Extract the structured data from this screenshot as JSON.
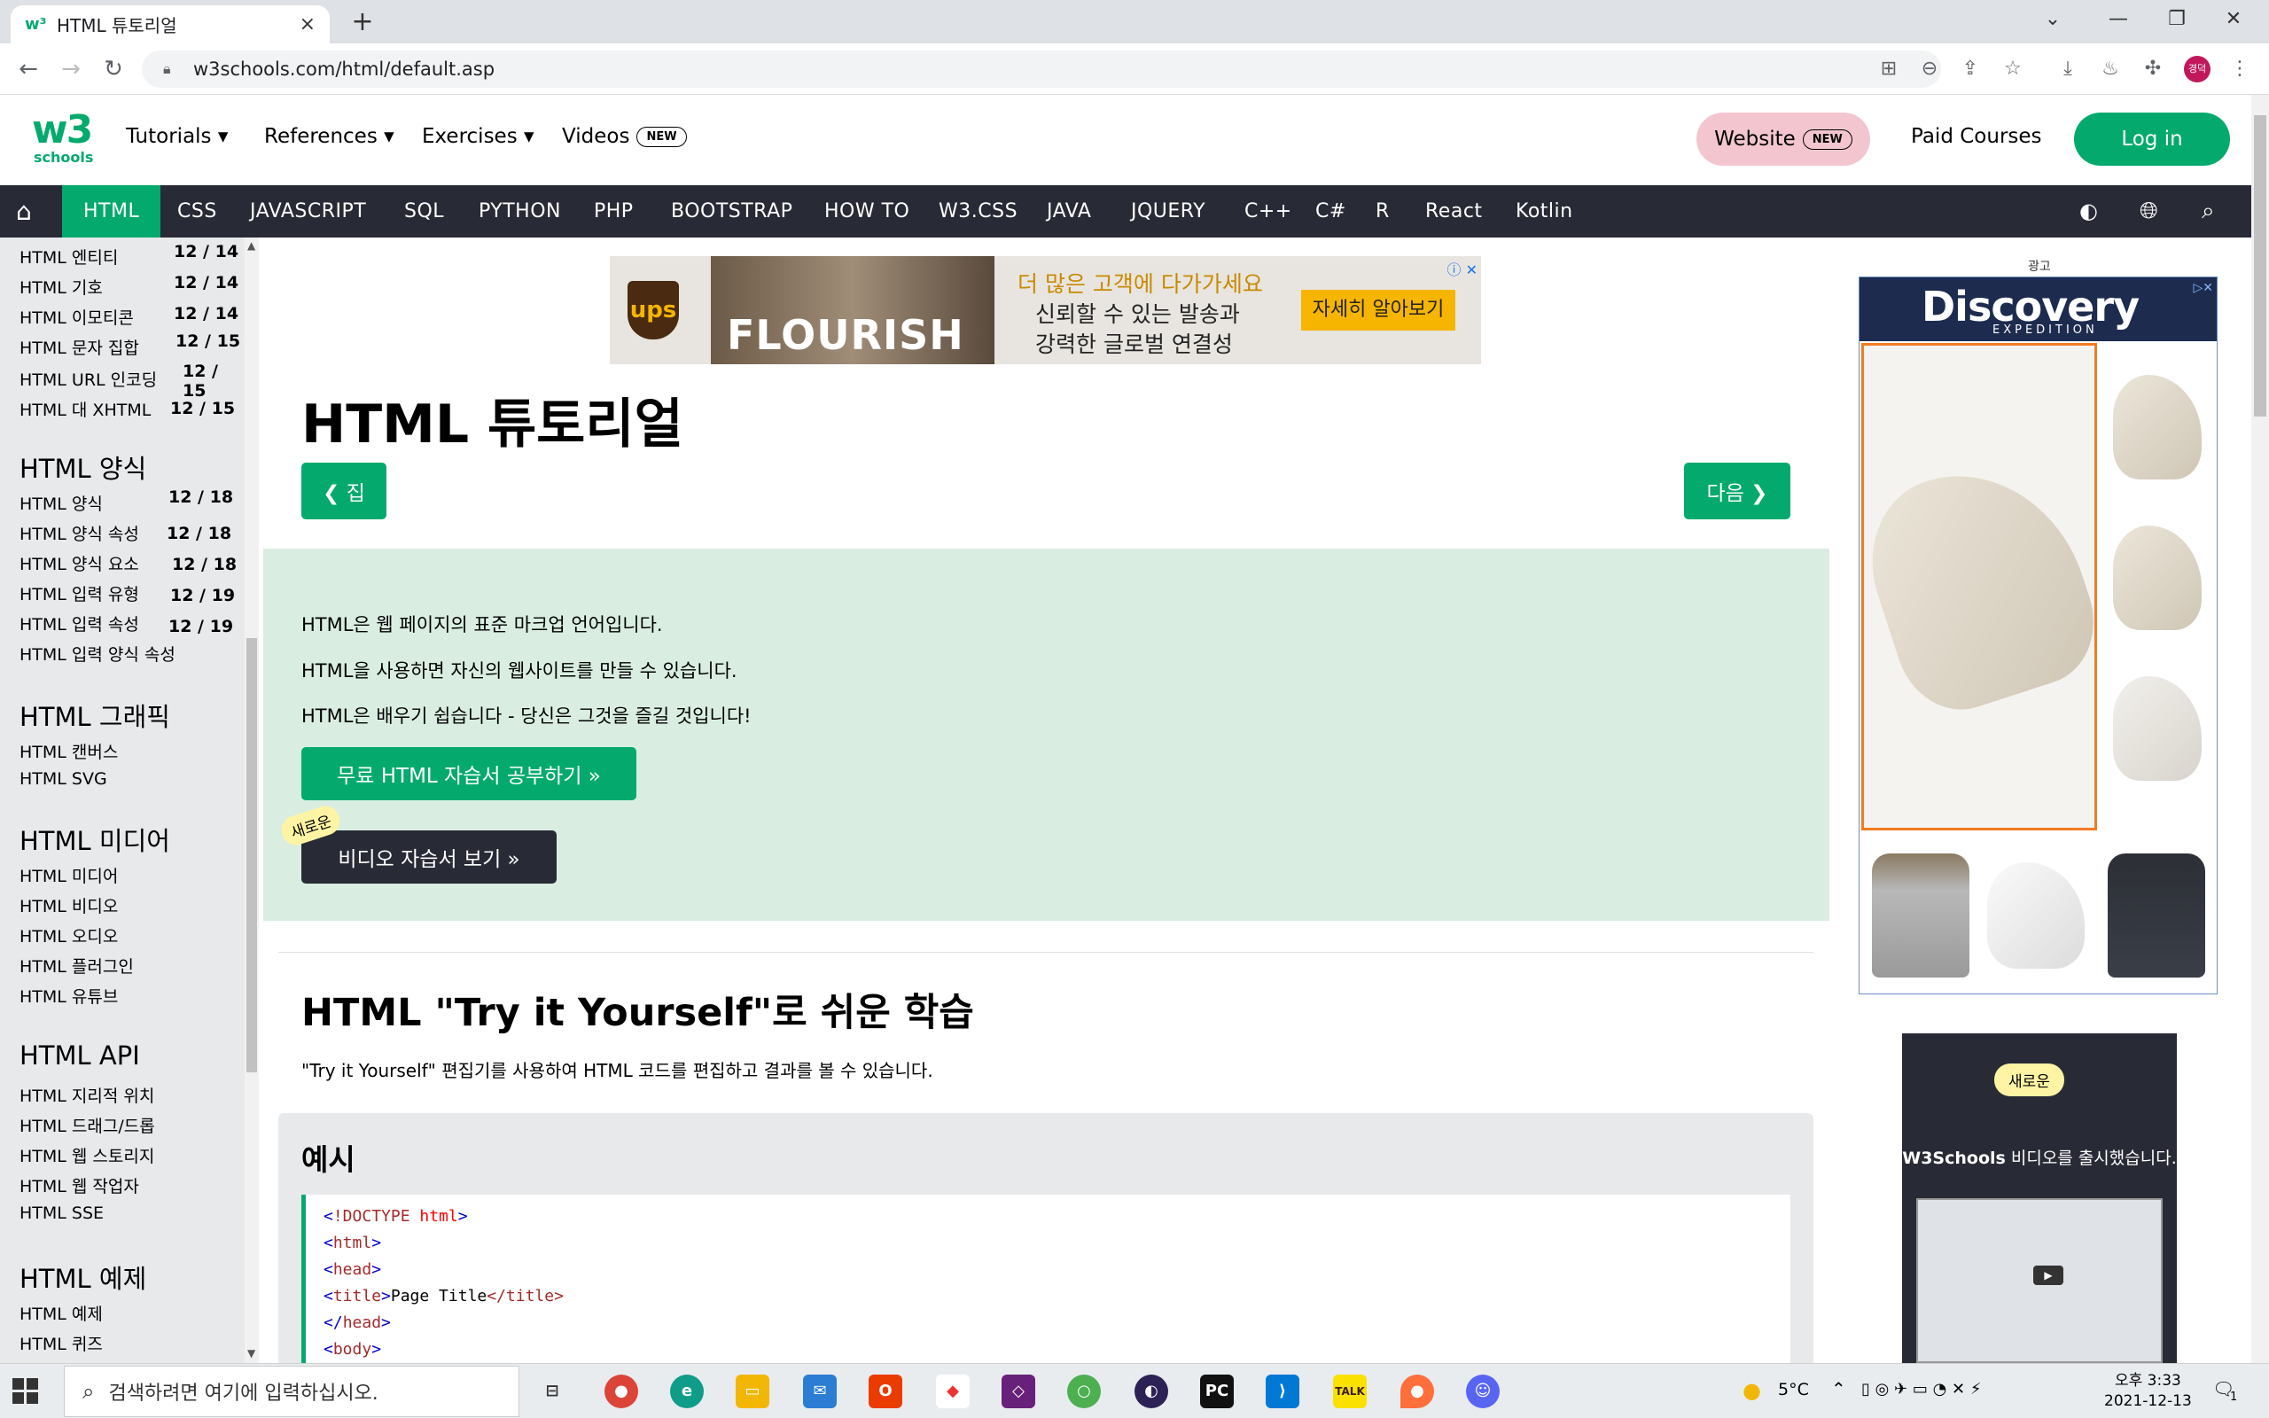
{
  "browser": {
    "tab_title": "HTML 튜토리얼",
    "tab_close": "×",
    "new_tab": "+",
    "url": "w3schools.com/html/default.asp",
    "profile_initials": "경덕"
  },
  "header": {
    "logo_w3": "w3",
    "logo_super": "3",
    "logo_schools": "schools",
    "nav": [
      {
        "label": "Tutorials"
      },
      {
        "label": "References"
      },
      {
        "label": "Exercises"
      },
      {
        "label": "Videos"
      }
    ],
    "videos_badge": "NEW",
    "website_label": "Website",
    "website_badge": "NEW",
    "paid_courses": "Paid Courses",
    "login": "Log in"
  },
  "topics": [
    "HTML",
    "CSS",
    "JAVASCRIPT",
    "SQL",
    "PYTHON",
    "PHP",
    "BOOTSTRAP",
    "HOW TO",
    "W3.CSS",
    "JAVA",
    "JQUERY",
    "C++",
    "C#",
    "R",
    "React",
    "Kotlin"
  ],
  "sidebar": {
    "items_top": [
      {
        "label": "HTML 엔티티",
        "badge": "12 / 14"
      },
      {
        "label": "HTML 기호",
        "badge": "12 / 14"
      },
      {
        "label": "HTML 이모티콘",
        "badge": "12 / 14"
      },
      {
        "label": "HTML 문자 집합",
        "badge": "12 / 15"
      },
      {
        "label": "HTML URL 인코딩",
        "badge": "12 / 15"
      },
      {
        "label": "HTML 대 XHTML",
        "badge": "12 / 15"
      }
    ],
    "forms_heading": "HTML 양식",
    "forms": [
      {
        "label": "HTML 양식",
        "badge": "12 / 18"
      },
      {
        "label": "HTML 양식 속성",
        "badge": "12 / 18"
      },
      {
        "label": "HTML 양식 요소",
        "badge": "12 / 18"
      },
      {
        "label": "HTML 입력 유형",
        "badge": "12 / 19"
      },
      {
        "label": "HTML 입력 속성",
        "badge": "12 / 19"
      },
      {
        "label": "HTML 입력 양식 속성",
        "badge": ""
      }
    ],
    "graphics_heading": "HTML 그래픽",
    "graphics": [
      "HTML 캔버스",
      "HTML SVG"
    ],
    "media_heading": "HTML 미디어",
    "media": [
      "HTML 미디어",
      "HTML 비디오",
      "HTML 오디오",
      "HTML 플러그인",
      "HTML 유튜브"
    ],
    "api_heading": "HTML API",
    "api": [
      "HTML 지리적 위치",
      "HTML 드래그/드롭",
      "HTML 웹 스토리지",
      "HTML 웹 작업자",
      "HTML SSE"
    ],
    "examples_heading": "HTML 예제",
    "examples": [
      "HTML 예제",
      "HTML 퀴즈"
    ]
  },
  "ad_banner": {
    "brand": "ups",
    "image_text": "FLOURISH",
    "line1": "더 많은 고객에 다가가세요",
    "line2": "신뢰할 수 있는 발송과",
    "line3": "강력한 글로벌 연결성",
    "cta": "자세히 알아보기",
    "close": "ⓘ ✕"
  },
  "main": {
    "title": "HTML 튜토리얼",
    "prev_label": "❮ 집",
    "next_label": "다음 ❯",
    "intro": [
      "HTML은 웹 페이지의 표준 마크업 언어입니다.",
      "HTML을 사용하면 자신의 웹사이트를 만들 수 있습니다.",
      "HTML은 배우기 쉽습니다 - 당신은 그것을 즐길 것입니다!"
    ],
    "study_button": "무료 HTML 자습서 공부하기 »",
    "new_tag": "새로운",
    "video_button": "비디오 자습서 보기 »",
    "try_heading": "HTML \"Try it Yourself\"로 쉬운 학습",
    "try_paragraph": "\"Try it Yourself\" 편집기를 사용하여 HTML 코드를 편집하고 결과를 볼 수 있습니다.",
    "example_heading": "예시",
    "code": [
      {
        "open": "<",
        "tag": "!DOCTYPE",
        "attr": " html",
        "close": ">"
      },
      {
        "open": "<",
        "tag": "html",
        "attr": "",
        "close": ">"
      },
      {
        "open": "<",
        "tag": "head",
        "attr": "",
        "close": ">"
      },
      {
        "open": "<",
        "tag": "title",
        "attr": "",
        "close": ">",
        "text": "Page Title",
        "end": "</title>"
      },
      {
        "open": "</",
        "tag": "head",
        "attr": "",
        "close": ">"
      },
      {
        "open": "<",
        "tag": "body",
        "attr": "",
        "close": ">"
      }
    ]
  },
  "right_ads": {
    "label": "광고",
    "brand": "Discovery",
    "sub": "EXPEDITION",
    "video_pill": "새로운",
    "video_text_bold": "W3Schools",
    "video_text": " 비디오를 출시했습니다."
  },
  "taskbar": {
    "search_placeholder": "검색하려면 여기에 입력하십시오.",
    "weather": "5°C",
    "time": "오후 3:33",
    "date": "2021-12-13",
    "notifications": "1",
    "kakao_label": "TALK"
  },
  "colors": {
    "w3_green": "#04aa6d",
    "dark_nav": "#282a35",
    "intro_bg": "#d9eee1",
    "sidebar_bg": "#e7e9eb",
    "website_pink": "#f3c6cf",
    "code_tag": "#a52a2a",
    "code_attr": "#ff0000",
    "code_bracket": "#0000cd"
  }
}
